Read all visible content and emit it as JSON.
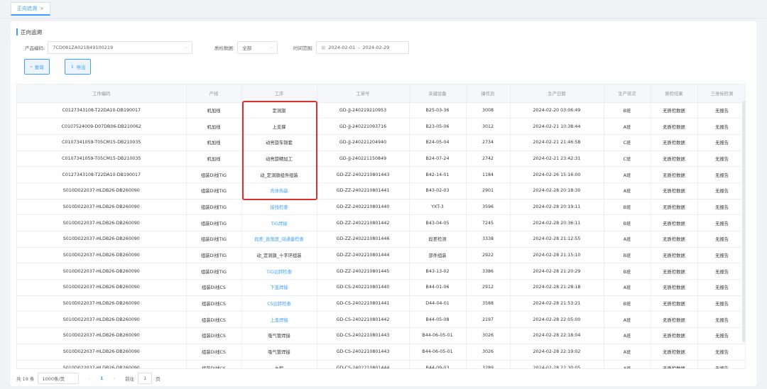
{
  "tab": {
    "label": "正向追溯",
    "close": "×"
  },
  "section": {
    "title": "正向追溯"
  },
  "filters": {
    "product_code": {
      "label": "产品编码:",
      "value": "7CD081ZA021B49100219"
    },
    "qc_data": {
      "label": "质检数据:",
      "value": "全部"
    },
    "time_range": {
      "label": "时间范围:",
      "start": "2024-02-01",
      "sep": "-",
      "end": "2024-02-29"
    }
  },
  "buttons": {
    "search": "查询",
    "export": "导出"
  },
  "table": {
    "headers": [
      "工件编码",
      "产线",
      "工序",
      "工单号",
      "关键设备",
      "操作员",
      "生产日期",
      "生产班次",
      "质检结果",
      "三坐标检测"
    ],
    "rows": [
      [
        "C0127343108-T22DA10-DB190017",
        "机加线",
        "定洞旗",
        "GD-JJ-240219210953",
        "B25-03-36",
        "3008",
        "2024-02-20 03:06:49",
        "B班",
        "无质检数据",
        "无报告"
      ],
      [
        "C0107524009-D07DB06-DB210062",
        "机加线",
        "上支撑",
        "GD-JJ-240221093716",
        "B23-05-06",
        "3012",
        "2024-02-21 10:38:44",
        "A班",
        "无质检数据",
        "无报告"
      ],
      [
        "C0107341059-T05CM15-DB210035",
        "机加线",
        "动亮旋车铜套",
        "GD-JJ-240221204940",
        "B24-05-04",
        "2734",
        "2024-02-21 21:46:58",
        "C班",
        "无质检数据",
        "无报告"
      ],
      [
        "C0107341059-T05CM15-DB210035",
        "机加线",
        "动亮旋精加工",
        "GD-JJ-240221150849",
        "B24-07-24",
        "2742",
        "2024-02-21 23:42:31",
        "C班",
        "无质检数据",
        "无报告"
      ],
      [
        "C0127343108-T22DA10-DB190017",
        "组装Di线TIG",
        "动_定洞旗组件组装",
        "GD-ZZ-2402210801443",
        "B42-14-01",
        "1184",
        "2024-02-26 15:16:00",
        "A班",
        "无质检数据",
        "无报告"
      ],
      [
        "S010D022037-HLDB26-DB260090",
        "组装Di线TIG",
        "壳体热装",
        "GD-ZZ-2402210801441",
        "B43-02-03",
        "2901",
        "2024-02-28 20:18:30",
        "A班",
        "无质检数据",
        "无报告"
      ],
      [
        "S010D022037-HLDB26-DB260090",
        "组装Di线TIG",
        "接线检查",
        "GD-ZZ-2402210801440",
        "YXT-3",
        "3596",
        "2024-02-28 20:19:11",
        "B班",
        "无质检数据",
        "无报告"
      ],
      [
        "S010D022037-HLDB26-DB260090",
        "组装Di线TIG",
        "TIG焊接",
        "GD-ZZ-2402210801442",
        "B43-04-05",
        "7245",
        "2024-02-28 20:36:11",
        "B班",
        "无质检数据",
        "无报告"
      ],
      [
        "S010D022037-HLDB26-DB260090",
        "组装Di线TIG",
        "段差_直角度_间通量检查",
        "GD-ZZ-2402210801446",
        "段差检测",
        "3338",
        "2024-02-28 21:12:55",
        "A班",
        "无质检数据",
        "无报告"
      ],
      [
        "S010D022037-HLDB26-DB260090",
        "组装Di线TIG",
        "动_定洞旗_十字环组装",
        "GD-ZZ-2402210801444",
        "部件组装",
        "2922",
        "2024-02-28 21:15:10",
        "B班",
        "无质检数据",
        "无报告"
      ],
      [
        "S010D022037-HLDB26-DB260090",
        "组装Di线TIG",
        "TIG远转检查",
        "GD-ZZ-2402210801445",
        "B43-13-02",
        "3386",
        "2024-02-28 21:20:29",
        "B班",
        "无质检数据",
        "无报告"
      ],
      [
        "S010D022037-HLDB26-DB260090",
        "组装Di线CS",
        "下盖焊接",
        "GD-CS-2402210801440",
        "B44-01-06",
        "2912",
        "2024-02-28 21:28:18",
        "A班",
        "无质检数据",
        "无报告"
      ],
      [
        "S010D022037-HLDB26-DB260090",
        "组装Di线CS",
        "CS远转检查",
        "GD-CS-2402210801441",
        "D44-04-01",
        "3588",
        "2024-02-28 21:53:21",
        "B班",
        "无质检数据",
        "无报告"
      ],
      [
        "S010D022037-HLDB26-DB260090",
        "组装Di线CS",
        "上盖焊接",
        "GD-CS-2402210801442",
        "B44-05-08",
        "2197",
        "2024-02-28 22:05:00",
        "A班",
        "无质检数据",
        "无报告"
      ],
      [
        "S010D022037-HLDB26-DB260090",
        "组装Di线CS",
        "吸气管焊接",
        "GD-CS-2402210801443",
        "B44-06-05-01",
        "3026",
        "2024-02-28 22:18:04",
        "A班",
        "无质检数据",
        "无报告"
      ],
      [
        "S010D022037-HLDB26-DB260090",
        "组装Di线CS",
        "吸气管焊接",
        "GD-CS-2402210801443",
        "B44-06-05-01",
        "3026",
        "2024-02-28 22:19:02",
        "A班",
        "无质检数据",
        "无报告"
      ],
      [
        "S010D022037-HLDB26-DB260090",
        "组装Di线CS",
        "水检",
        "GD-CS-2402210801444",
        "B44-09-03",
        "3289",
        "2024-02-28 22:30:05",
        "A班",
        "无质检数据",
        "无报告"
      ]
    ],
    "link_rows": [
      5,
      6,
      7,
      8,
      10,
      11,
      12,
      13
    ]
  },
  "pagination": {
    "total": "共 19 条",
    "page_size": "1000条/页",
    "prev": "‹",
    "current": "1",
    "next": "›",
    "goto_label": "前往",
    "goto_value": "1",
    "page_suffix": "页"
  },
  "colors": {
    "accent": "#409eff",
    "highlight": "#d9312b"
  }
}
